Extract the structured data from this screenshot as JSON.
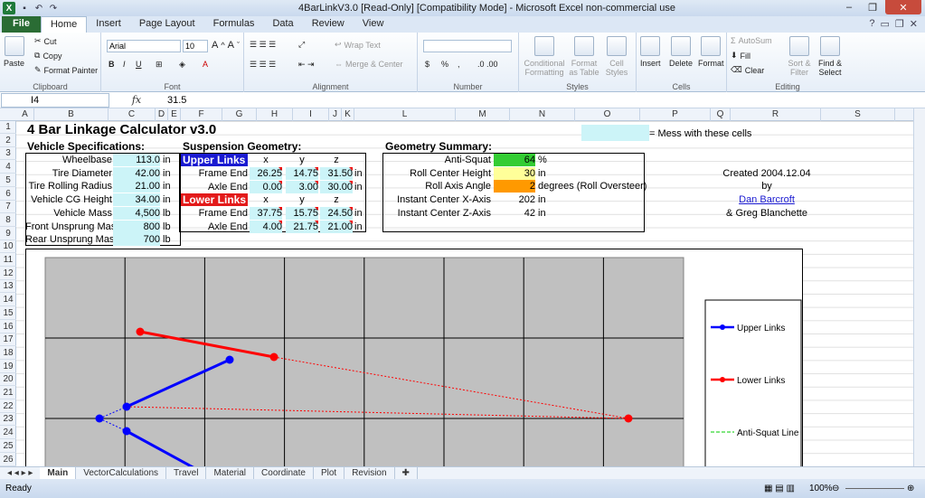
{
  "window": {
    "title": "4BarLinkV3.0  [Read-Only]  [Compatibility Mode]  -  Microsoft Excel non-commercial use"
  },
  "ribbon_tabs": [
    "File",
    "Home",
    "Insert",
    "Page Layout",
    "Formulas",
    "Data",
    "Review",
    "View"
  ],
  "ribbon": {
    "clipboard": {
      "paste": "Paste",
      "cut": "Cut",
      "copy": "Copy",
      "format_painter": "Format Painter",
      "label": "Clipboard"
    },
    "font": {
      "name": "Arial",
      "size": "10",
      "bold": "B",
      "italic": "I",
      "underline": "U",
      "label": "Font"
    },
    "alignment": {
      "wrap": "Wrap Text",
      "merge": "Merge & Center",
      "label": "Alignment"
    },
    "number": {
      "label": "Number",
      "currency": "$",
      "percent": "%",
      "comma": ","
    },
    "styles": {
      "conditional": "Conditional Formatting",
      "format_table": "Format as Table",
      "cell_styles": "Cell Styles",
      "label": "Styles"
    },
    "cells": {
      "insert": "Insert",
      "delete": "Delete",
      "format": "Format",
      "label": "Cells"
    },
    "editing": {
      "autosum": "AutoSum",
      "fill": "Fill",
      "clear": "Clear",
      "sort": "Sort & Filter",
      "find": "Find & Select",
      "label": "Editing"
    }
  },
  "formula_bar": {
    "name_box": "I4",
    "fx": "fx",
    "value": "31.5"
  },
  "columns": [
    "A",
    "B",
    "C",
    "D",
    "E",
    "F",
    "G",
    "H",
    "I",
    "J",
    "K",
    "L",
    "M",
    "N",
    "O",
    "P",
    "Q",
    "R",
    "S"
  ],
  "rows": [
    "1",
    "2",
    "3",
    "4",
    "5",
    "6",
    "7",
    "8",
    "9",
    "10",
    "11",
    "12",
    "13",
    "14",
    "15",
    "16",
    "17",
    "18",
    "19",
    "20",
    "21",
    "22",
    "23",
    "24",
    "25",
    "26"
  ],
  "sheet": {
    "title": "4 Bar Linkage Calculator v3.0",
    "legend_note": "= Mess with these cells",
    "vehicle": {
      "header": "Vehicle Specifications:",
      "rows": [
        {
          "label": "Wheelbase",
          "value": "113.0",
          "unit": "in"
        },
        {
          "label": "Tire Diameter",
          "value": "42.00",
          "unit": "in"
        },
        {
          "label": "Tire Rolling Radius",
          "value": "21.00",
          "unit": "in"
        },
        {
          "label": "Vehicle CG Height",
          "value": "34.00",
          "unit": "in"
        },
        {
          "label": "Vehicle Mass",
          "value": "4,500",
          "unit": "lb"
        },
        {
          "label": "Front Unsprung Mass",
          "value": "800",
          "unit": "lb"
        },
        {
          "label": "Rear Unsprung Mass",
          "value": "700",
          "unit": "lb"
        }
      ]
    },
    "suspension": {
      "header": "Suspension Geometry:",
      "upper_label": "Upper Links",
      "lower_label": "Lower Links",
      "axes": [
        "x",
        "y",
        "z"
      ],
      "upper": [
        {
          "label": "Frame End",
          "x": "26.25",
          "y": "14.75",
          "z": "31.50",
          "unit": "in"
        },
        {
          "label": "Axle End",
          "x": "0.00",
          "y": "3.00",
          "z": "30.00",
          "unit": "in"
        }
      ],
      "lower": [
        {
          "label": "Frame End",
          "x": "37.75",
          "y": "15.75",
          "z": "24.50",
          "unit": "in"
        },
        {
          "label": "Axle End",
          "x": "4.00",
          "y": "21.75",
          "z": "21.00",
          "unit": "in"
        }
      ]
    },
    "summary": {
      "header": "Geometry Summary:",
      "rows": [
        {
          "label": "Anti-Squat",
          "value": "64",
          "unit": "%"
        },
        {
          "label": "Roll Center Height",
          "value": "30",
          "unit": "in"
        },
        {
          "label": "Roll Axis Angle",
          "value": "2",
          "unit": "degrees (Roll Oversteer)"
        },
        {
          "label": "Instant Center X-Axis",
          "value": "202",
          "unit": "in"
        },
        {
          "label": "Instant Center Z-Axis",
          "value": "42",
          "unit": "in"
        }
      ],
      "colors": {
        "anti_squat": "#33cc33",
        "roll_center": "#ffff99",
        "roll_axis": "#ff9900"
      }
    },
    "credits": {
      "created": "Created 2004.12.04",
      "by": "by",
      "author1": "Dan Barcroft",
      "author2": "& Greg Blanchette"
    }
  },
  "chart_data": {
    "type": "line",
    "legend": [
      "Upper Links",
      "Lower Links",
      "Anti-Squat Line"
    ],
    "colors": {
      "upper": "#0000ff",
      "lower": "#ff0000",
      "anti_squat": "#00cc00",
      "plot_bg": "#c0c0c0"
    }
  },
  "sheet_tabs": [
    "Main",
    "VectorCalculations",
    "Travel",
    "Material",
    "Coordinate",
    "Plot",
    "Revision"
  ],
  "status": {
    "ready": "Ready",
    "zoom": "100%"
  }
}
